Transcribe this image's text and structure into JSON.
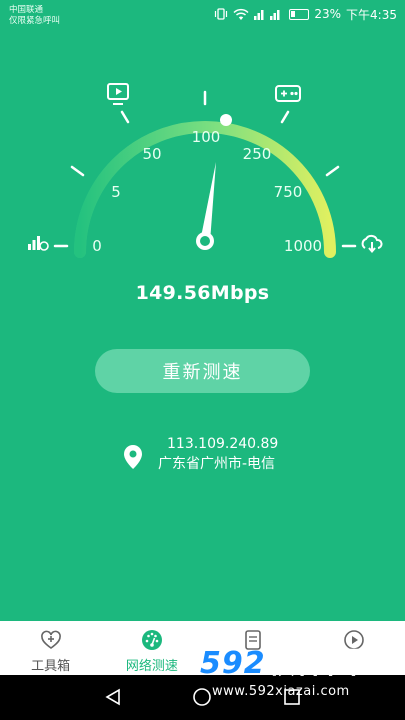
{
  "status_bar": {
    "carrier": "中国联通",
    "emergency": "仅限紧急呼叫",
    "battery": "23%",
    "time": "下午4:35"
  },
  "gauge": {
    "ticks": [
      "0",
      "5",
      "50",
      "100",
      "250",
      "750",
      "1000"
    ],
    "needle_value_mbps": 149.56
  },
  "result": {
    "speed": "149.56Mbps"
  },
  "retest_button": {
    "label": "重新测速"
  },
  "ip_info": {
    "ip": "113.109.240.89",
    "location": "广东省广州市-电信"
  },
  "bottom_nav": {
    "items": [
      {
        "label": "工具箱",
        "icon": "heart-plus-icon",
        "active": false
      },
      {
        "label": "网络测速",
        "icon": "speedometer-icon",
        "active": true
      },
      {
        "label": "",
        "icon": "document-icon",
        "active": false
      },
      {
        "label": "",
        "icon": "play-icon",
        "active": false
      }
    ]
  },
  "watermark": {
    "brand_num": "592",
    "brand_cn": "软件园",
    "url": "www.592xiazai.com"
  },
  "colors": {
    "background": "#1cb87e",
    "button": "#5fd3a6",
    "nav_active": "#1cb87e",
    "watermark_orange": "#ff7a1a",
    "watermark_blue": "#1a8cff"
  }
}
